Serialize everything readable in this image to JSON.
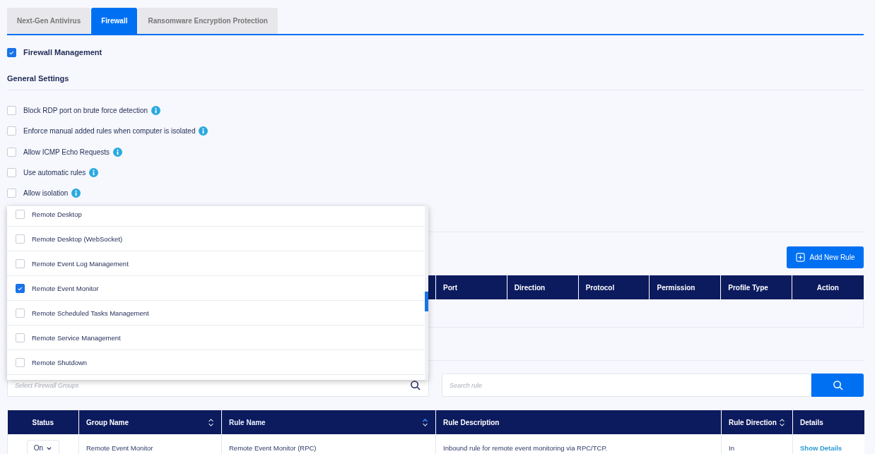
{
  "tabs": [
    {
      "label": "Next-Gen Antivirus",
      "selected": false
    },
    {
      "label": "Firewall",
      "selected": true
    },
    {
      "label": "Ransomware Encryption Protection",
      "selected": false
    }
  ],
  "firewall_management": {
    "label": "Firewall Management",
    "checked": true
  },
  "general_settings": {
    "title": "General Settings",
    "options": [
      {
        "label": "Block RDP port on brute force detection",
        "checked": false
      },
      {
        "label": "Enforce manual added rules when computer is isolated",
        "checked": false
      },
      {
        "label": "Allow ICMP Echo Requests",
        "checked": false
      },
      {
        "label": "Use automatic rules",
        "checked": false
      },
      {
        "label": "Allow isolation",
        "checked": false
      }
    ]
  },
  "manual_rules": {
    "add_button": "Add New Rule",
    "columns": [
      "Port",
      "Direction",
      "Protocol",
      "Permission",
      "Profile Type",
      "Action"
    ]
  },
  "group_dropdown": {
    "items": [
      {
        "label": "Remote Desktop",
        "checked": false
      },
      {
        "label": "Remote Desktop (WebSocket)",
        "checked": false
      },
      {
        "label": "Remote Event Log Management",
        "checked": false
      },
      {
        "label": "Remote Event Monitor",
        "checked": true
      },
      {
        "label": "Remote Scheduled Tasks Management",
        "checked": false
      },
      {
        "label": "Remote Service Management",
        "checked": false
      },
      {
        "label": "Remote Shutdown",
        "checked": false
      }
    ]
  },
  "filters": {
    "group_placeholder": "Select Firewall Groups",
    "search_placeholder": "Search rule"
  },
  "rules_table": {
    "columns": [
      {
        "label": "Status",
        "sortable": false
      },
      {
        "label": "Group Name",
        "sortable": true,
        "sorted": false
      },
      {
        "label": "Rule Name",
        "sortable": true,
        "sorted": true
      },
      {
        "label": "Rule Description",
        "sortable": false
      },
      {
        "label": "Rule Direction",
        "sortable": true,
        "sorted": false
      },
      {
        "label": "Details",
        "sortable": false
      }
    ],
    "rows": [
      {
        "status": "On",
        "group": "Remote Event Monitor",
        "rule": "Remote Event Monitor (RPC)",
        "description": "Inbound rule for remote event monitoring via RPC/TCP.",
        "direction": "In",
        "details": "Show Details"
      }
    ]
  }
}
